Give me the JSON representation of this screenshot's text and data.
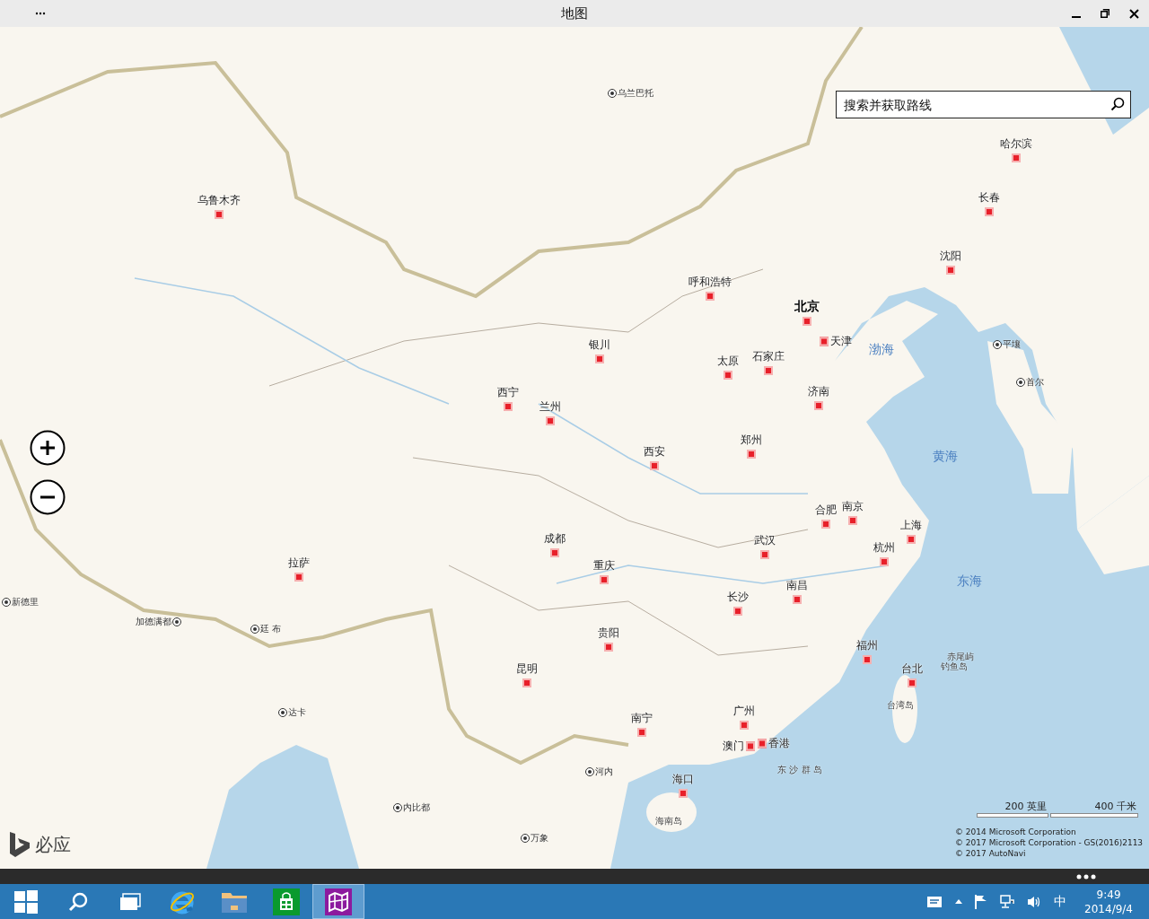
{
  "window": {
    "title": "地图"
  },
  "search": {
    "placeholder": "搜索并获取路线"
  },
  "map_labels": [
    {
      "kind": "foreign",
      "text": "乌兰巴托"
    },
    {
      "kind": "city",
      "text": "乌鲁木齐"
    },
    {
      "kind": "city",
      "text": "哈尔滨"
    },
    {
      "kind": "city",
      "text": "长春"
    },
    {
      "kind": "city",
      "text": "沈阳"
    },
    {
      "kind": "city",
      "text": "呼和浩特"
    },
    {
      "kind": "capital",
      "text": "北京"
    },
    {
      "kind": "city",
      "text": "银川"
    },
    {
      "kind": "city_right",
      "text": "天津"
    },
    {
      "kind": "sea",
      "text": "渤海"
    },
    {
      "kind": "foreign",
      "text": "平壤"
    },
    {
      "kind": "city",
      "text": "太原"
    },
    {
      "kind": "city",
      "text": "石家庄"
    },
    {
      "kind": "foreign",
      "text": "首尔"
    },
    {
      "kind": "city",
      "text": "西宁"
    },
    {
      "kind": "city",
      "text": "济南"
    },
    {
      "kind": "city",
      "text": "兰州"
    },
    {
      "kind": "city",
      "text": "西安"
    },
    {
      "kind": "city",
      "text": "郑州"
    },
    {
      "kind": "sea",
      "text": "黄海"
    },
    {
      "kind": "city",
      "text": "合肥"
    },
    {
      "kind": "city",
      "text": "南京"
    },
    {
      "kind": "city",
      "text": "上海"
    },
    {
      "kind": "city",
      "text": "成都"
    },
    {
      "kind": "city",
      "text": "武汉"
    },
    {
      "kind": "city",
      "text": "杭州"
    },
    {
      "kind": "city",
      "text": "拉萨"
    },
    {
      "kind": "city",
      "text": "重庆"
    },
    {
      "kind": "city",
      "text": "南昌"
    },
    {
      "kind": "sea",
      "text": "东海"
    },
    {
      "kind": "foreign",
      "text": "新德里"
    },
    {
      "kind": "city",
      "text": "长沙"
    },
    {
      "kind": "foreign_left",
      "text": "加德满都"
    },
    {
      "kind": "foreign",
      "text": "廷 布"
    },
    {
      "kind": "city",
      "text": "贵阳"
    },
    {
      "kind": "city",
      "text": "福州"
    },
    {
      "kind": "island",
      "text": "赤尾屿"
    },
    {
      "kind": "city",
      "text": "昆明"
    },
    {
      "kind": "city",
      "text": "台北"
    },
    {
      "kind": "island",
      "text": "钓鱼岛"
    },
    {
      "kind": "foreign",
      "text": "达卡"
    },
    {
      "kind": "island",
      "text": "台湾岛"
    },
    {
      "kind": "city",
      "text": "南宁"
    },
    {
      "kind": "city",
      "text": "广州"
    },
    {
      "kind": "city_left",
      "text": "澳门"
    },
    {
      "kind": "city_right",
      "text": "香港"
    },
    {
      "kind": "foreign",
      "text": "河内"
    },
    {
      "kind": "island",
      "text": "东 沙 群 岛"
    },
    {
      "kind": "city",
      "text": "海口"
    },
    {
      "kind": "foreign",
      "text": "内比都"
    },
    {
      "kind": "island",
      "text": "海南岛"
    },
    {
      "kind": "foreign",
      "text": "万象"
    }
  ],
  "logo": {
    "text": "必应"
  },
  "scale": {
    "miles": "200 英里",
    "km": "400 千米"
  },
  "copyright": [
    "© 2014 Microsoft Corporation",
    "© 2017 Microsoft Corporation - GS(2016)2113",
    "© 2017 AutoNavi"
  ],
  "taskbar": {
    "apps": [
      {
        "kind": "start",
        "selected": false
      },
      {
        "kind": "search",
        "selected": false
      },
      {
        "kind": "taskview",
        "selected": false
      },
      {
        "kind": "ie",
        "selected": false
      },
      {
        "kind": "explorer",
        "selected": false
      },
      {
        "kind": "store",
        "selected": false
      },
      {
        "kind": "maps",
        "selected": true
      }
    ],
    "tray": {
      "ime": "中",
      "time": "9:49",
      "date": "2014/9/4"
    }
  }
}
